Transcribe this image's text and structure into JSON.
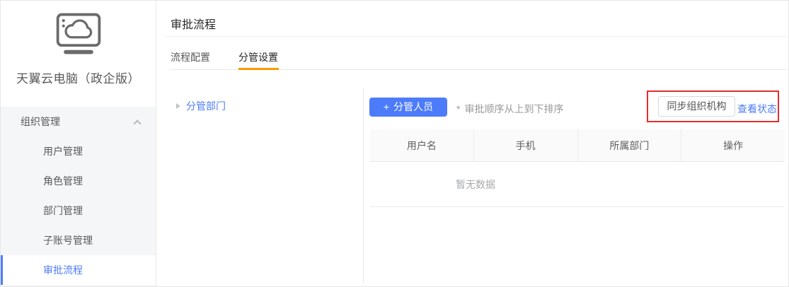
{
  "sidebar": {
    "brand": "天翼云电脑（政企版）",
    "group": {
      "label": "组织管理"
    },
    "items": [
      {
        "label": "用户管理"
      },
      {
        "label": "角色管理"
      },
      {
        "label": "部门管理"
      },
      {
        "label": "子账号管理"
      },
      {
        "label": "审批流程"
      }
    ],
    "active_item": "审批流程"
  },
  "page": {
    "title": "审批流程"
  },
  "tabs": [
    {
      "label": "流程配置",
      "active": false
    },
    {
      "label": "分管设置",
      "active": true
    }
  ],
  "tree": {
    "root_label": "分管部门"
  },
  "toolbar": {
    "add_icon": "+",
    "add_label": "分管人员",
    "note_mark": "*",
    "note_text": "审批顺序从上到下排序",
    "sync_label": "同步组织机构",
    "view_status_label": "查看状态"
  },
  "table": {
    "columns": [
      "用户名",
      "手机",
      "所属部门",
      "操作"
    ],
    "empty_text": "暂无数据",
    "rows": []
  },
  "colors": {
    "accent_blue": "#4d7cfa",
    "tab_active_orange": "#ff9900",
    "annotation_red": "#e02e2e",
    "sidebar_section_bg": "#f5f6f8",
    "table_header_bg": "#fafafa"
  }
}
